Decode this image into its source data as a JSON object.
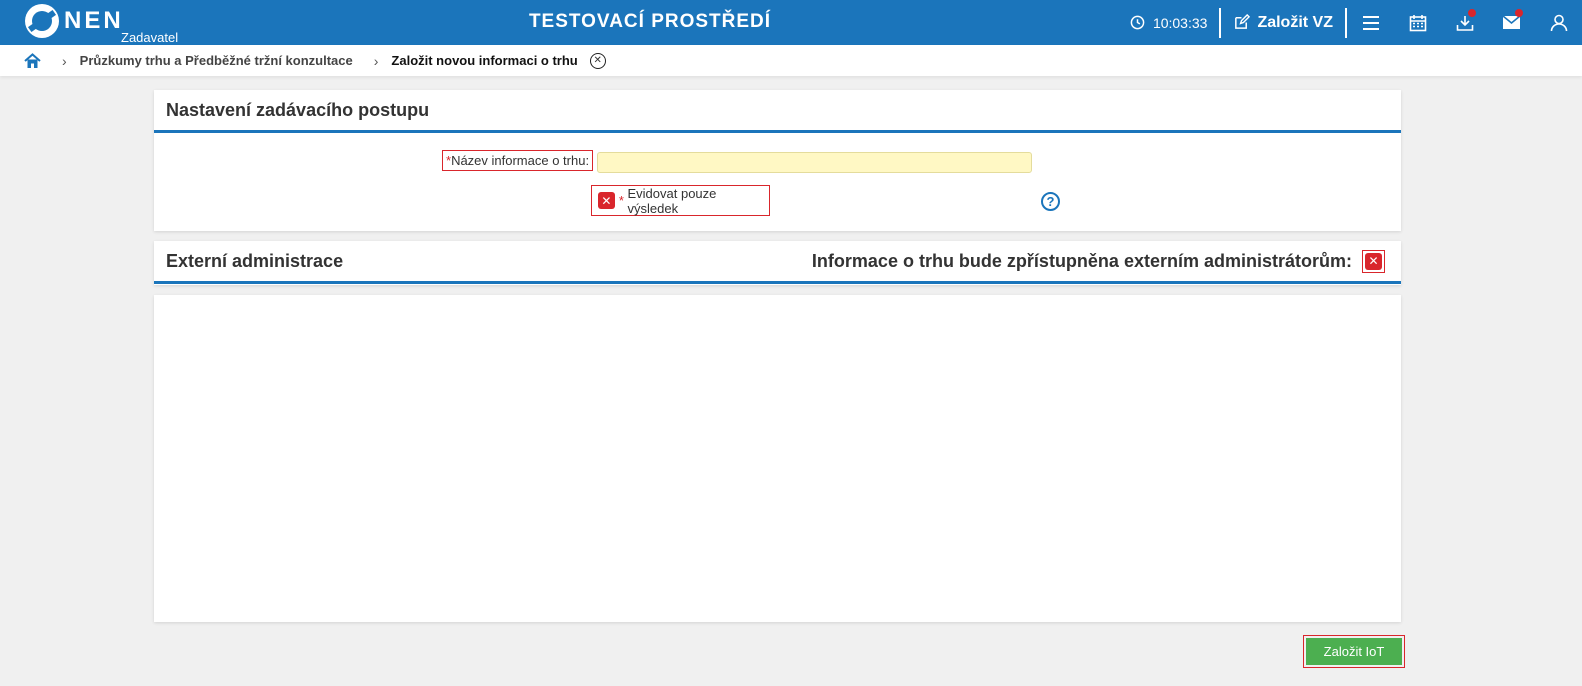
{
  "header": {
    "logo_text": "NEN",
    "logo_sub": "Zadavatel",
    "env_title": "TESTOVACÍ PROSTŘEDÍ",
    "time": "10:03:33",
    "create_vz_label": "Založit VZ"
  },
  "breadcrumb": {
    "items": [
      "Průzkumy trhu a Předběžné tržní konzultace"
    ],
    "current": "Založit novou informaci o trhu"
  },
  "section1": {
    "title": "Nastavení zadávacího postupu",
    "name_label": "Název informace o trhu:",
    "name_value": "",
    "checkbox_label": "Evidovat pouze výsledek",
    "required_mark": "*"
  },
  "section2": {
    "title": "Externí administrace",
    "right_label": "Informace o trhu bude zpřístupněna externím administrátorům:"
  },
  "footer": {
    "submit_label": "Založit IoT"
  },
  "colors": {
    "primary": "#1b75bb",
    "error": "#d9262c",
    "success": "#4caf50",
    "input_bg": "#fff8c4"
  }
}
